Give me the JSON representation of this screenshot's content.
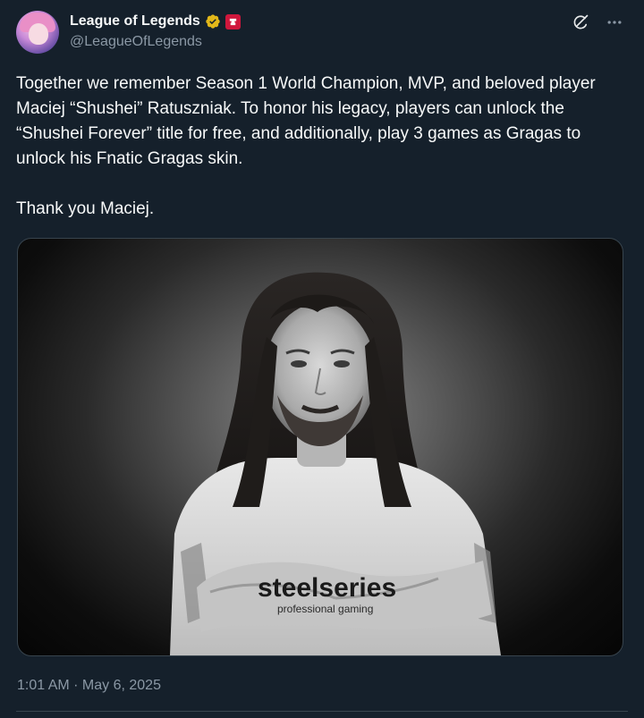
{
  "author": {
    "display_name": "League of Legends",
    "handle": "@LeagueOfLegends",
    "verified_badge_color": "#e2b719",
    "affiliate_badge_color": "#d0173c"
  },
  "actions": {
    "grok_icon": "grok-icon",
    "more_icon": "more-icon"
  },
  "tweet": {
    "paragraph_1": "Together we remember Season 1 World Champion, MVP, and beloved player Maciej “Shushei” Ratuszniak. To honor his legacy, players can unlock the “Shushei Forever” title for free, and additionally, play 3 games as Gragas to unlock his Fnatic Gragas skin.",
    "paragraph_2": "Thank you Maciej."
  },
  "media": {
    "jersey_text_1": "steelseries",
    "jersey_text_2": "professional gaming"
  },
  "footer": {
    "timestamp": "1:01 AM · May 6, 2025"
  },
  "colors": {
    "background": "#15202b",
    "text_primary": "#f7f9f9",
    "text_secondary": "#8b98a5",
    "border": "#38444d"
  }
}
